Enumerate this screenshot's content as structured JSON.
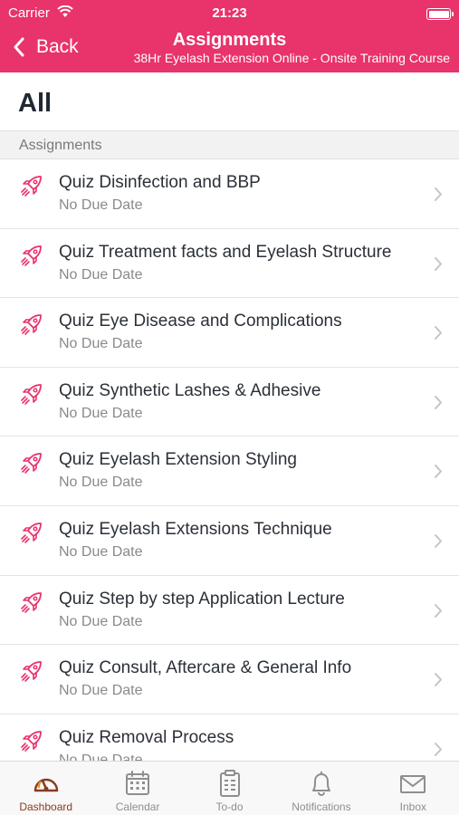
{
  "status_bar": {
    "carrier": "Carrier",
    "time": "21:23"
  },
  "header": {
    "back_label": "Back",
    "title": "Assignments",
    "subtitle": "38Hr Eyelash Extension Online - Onsite Training Course"
  },
  "page_title": "All",
  "section_header": "Assignments",
  "assignments": [
    {
      "name": "Quiz Disinfection and BBP",
      "due": "No Due Date"
    },
    {
      "name": "Quiz Treatment facts and Eyelash Structure",
      "due": "No Due Date"
    },
    {
      "name": "Quiz Eye Disease and Complications",
      "due": "No Due Date"
    },
    {
      "name": "Quiz Synthetic Lashes & Adhesive",
      "due": "No Due Date"
    },
    {
      "name": "Quiz Eyelash Extension Styling",
      "due": "No Due Date"
    },
    {
      "name": "Quiz Eyelash Extensions Technique",
      "due": "No Due Date"
    },
    {
      "name": "Quiz Step by step Application Lecture",
      "due": "No Due Date"
    },
    {
      "name": "Quiz Consult, Aftercare & General Info",
      "due": "No Due Date"
    },
    {
      "name": "Quiz Removal Process",
      "due": "No Due Date"
    }
  ],
  "tabs": [
    {
      "label": "Dashboard",
      "icon": "dashboard-gauge-icon",
      "active": true
    },
    {
      "label": "Calendar",
      "icon": "calendar-icon",
      "active": false
    },
    {
      "label": "To-do",
      "icon": "clipboard-icon",
      "active": false
    },
    {
      "label": "Notifications",
      "icon": "bell-icon",
      "active": false
    },
    {
      "label": "Inbox",
      "icon": "envelope-icon",
      "active": false
    }
  ],
  "colors": {
    "accent": "#e8336b",
    "active_tab": "#8a3a20",
    "icon_pink": "#e8336b"
  }
}
